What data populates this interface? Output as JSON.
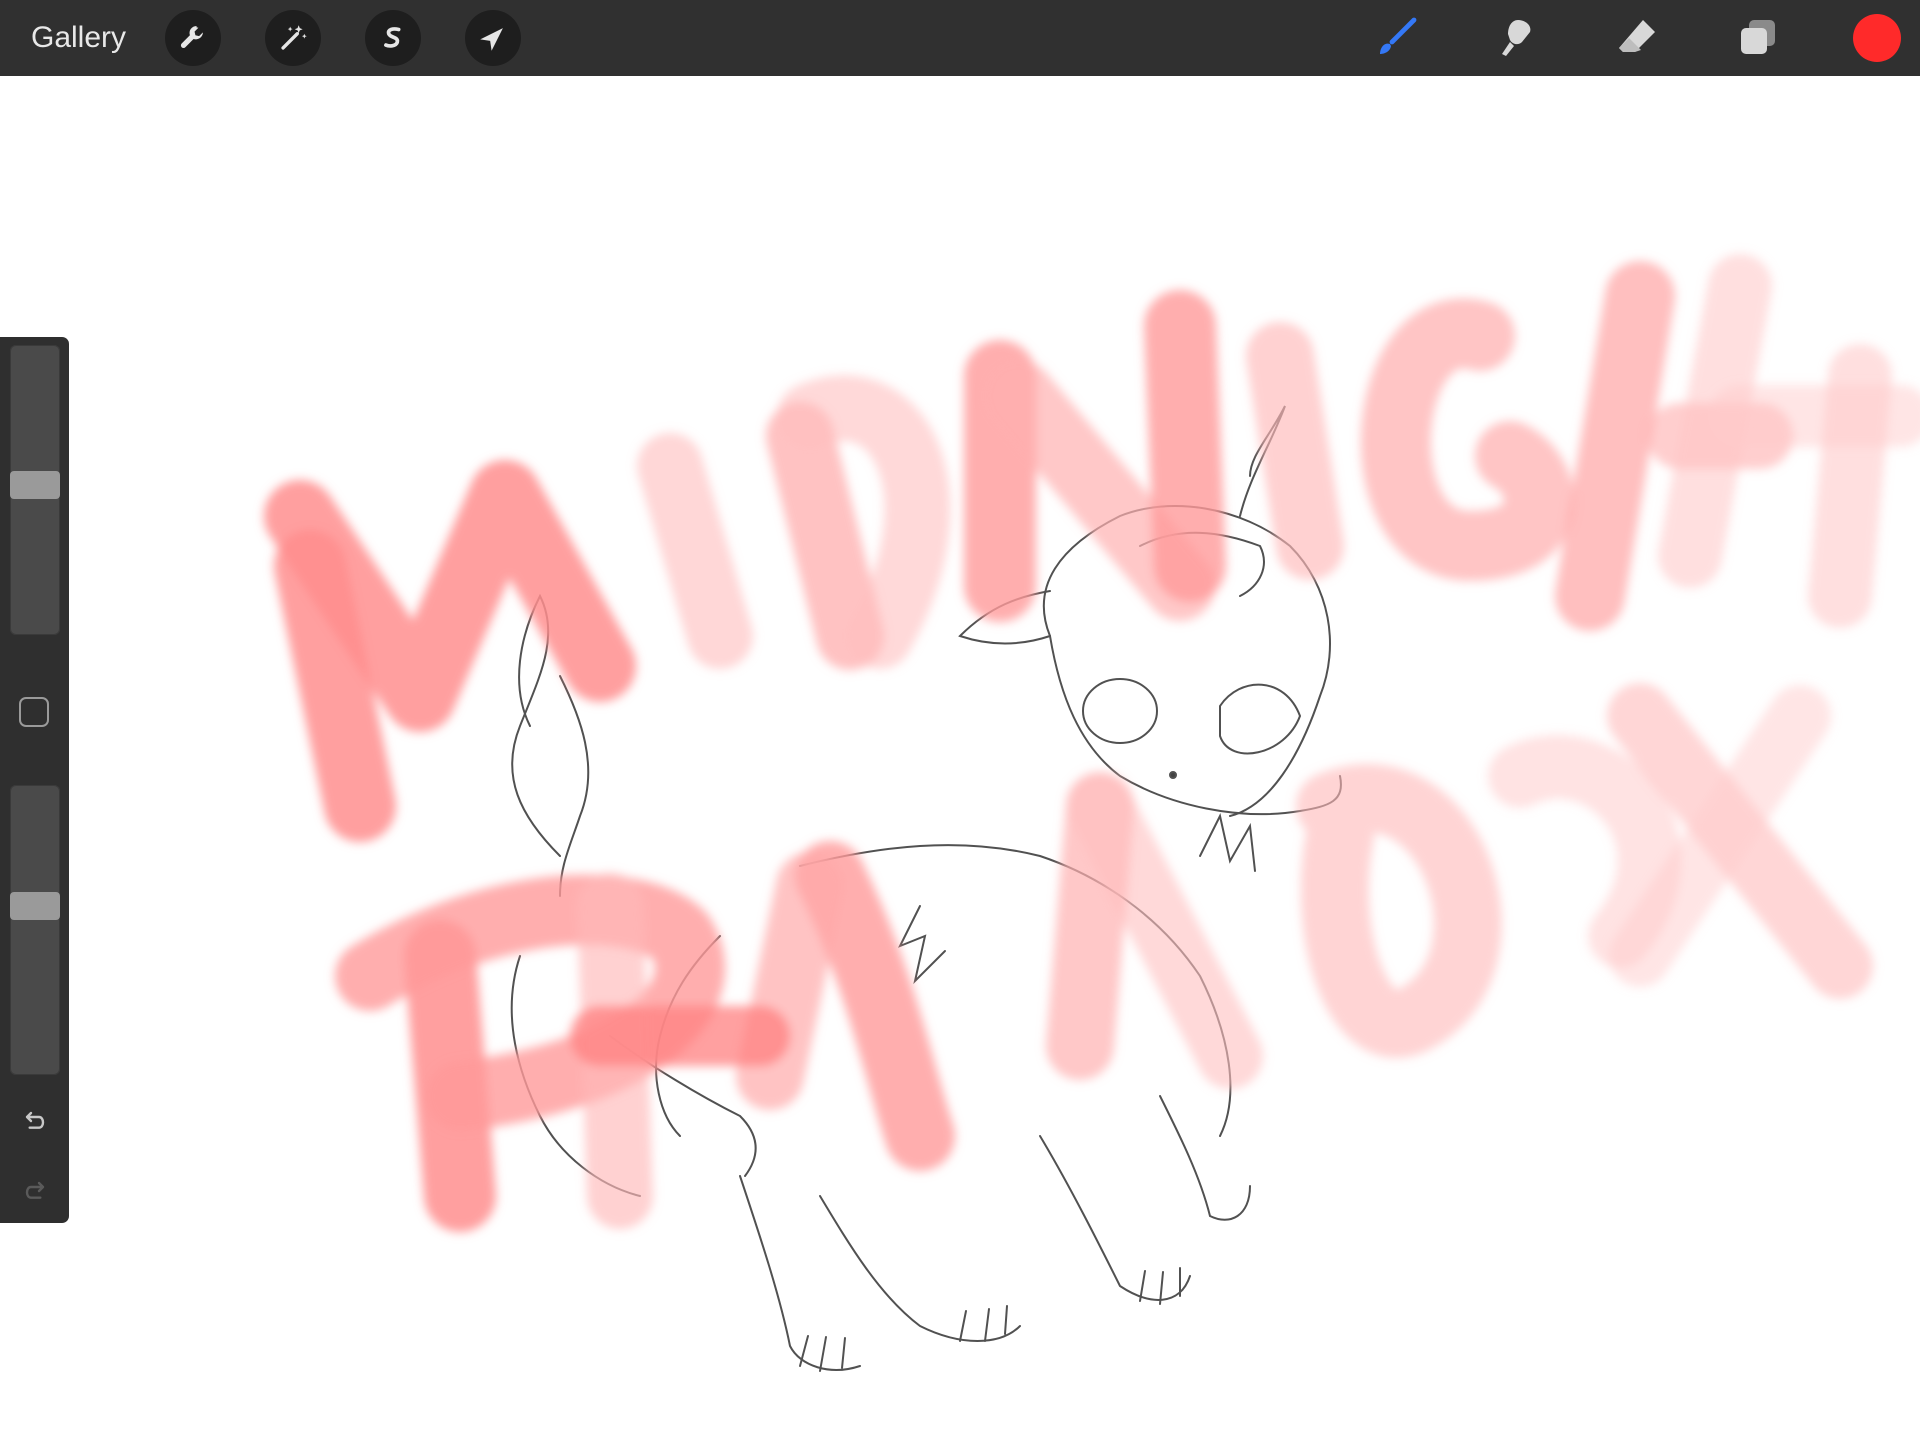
{
  "app": {
    "gallery_label": "Gallery"
  },
  "toolbar_left": [
    {
      "name": "actions",
      "icon": "wrench-icon"
    },
    {
      "name": "adjustments",
      "icon": "magic-wand-icon"
    },
    {
      "name": "selection",
      "icon": "selection-s-icon"
    },
    {
      "name": "transform",
      "icon": "arrow-cursor-icon"
    }
  ],
  "toolbar_right": [
    {
      "name": "brush",
      "icon": "brush-icon",
      "active": true
    },
    {
      "name": "smudge",
      "icon": "smudge-icon",
      "active": false
    },
    {
      "name": "eraser",
      "icon": "eraser-icon",
      "active": false
    },
    {
      "name": "layers",
      "icon": "layers-icon",
      "active": false
    }
  ],
  "colors": {
    "toolbar_bg": "#303030",
    "accent_brush": "#3478f6",
    "current_color": "#ff2a2a",
    "stroke_pink": "#ff8a8a"
  },
  "sidebar": {
    "brush_size_level": 0.52,
    "opacity_level": 0.59,
    "undo_icon": "undo-icon",
    "redo_icon": "redo-icon",
    "redo_enabled": false
  }
}
